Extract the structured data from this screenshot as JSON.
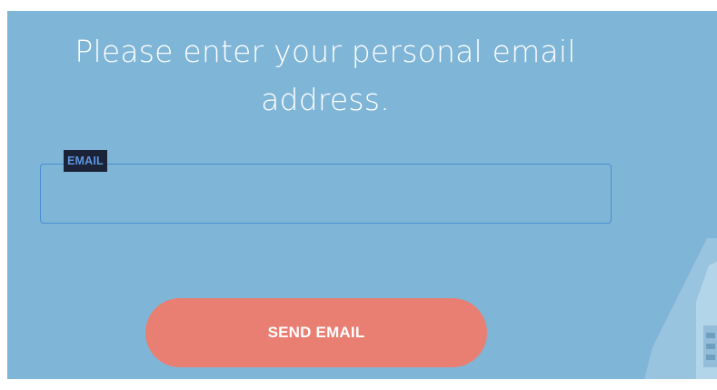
{
  "form": {
    "heading": "Please enter your personal email address.",
    "email_label": "EMAIL",
    "email_value": "",
    "email_placeholder": "",
    "submit_label": "SEND EMAIL"
  },
  "colors": {
    "panel_background": "#7fb5d6",
    "field_border": "#4a90d4",
    "label_background": "#1b2338",
    "label_text": "#5f95e0",
    "button_background": "#e97e73",
    "text": "#ffffff"
  }
}
